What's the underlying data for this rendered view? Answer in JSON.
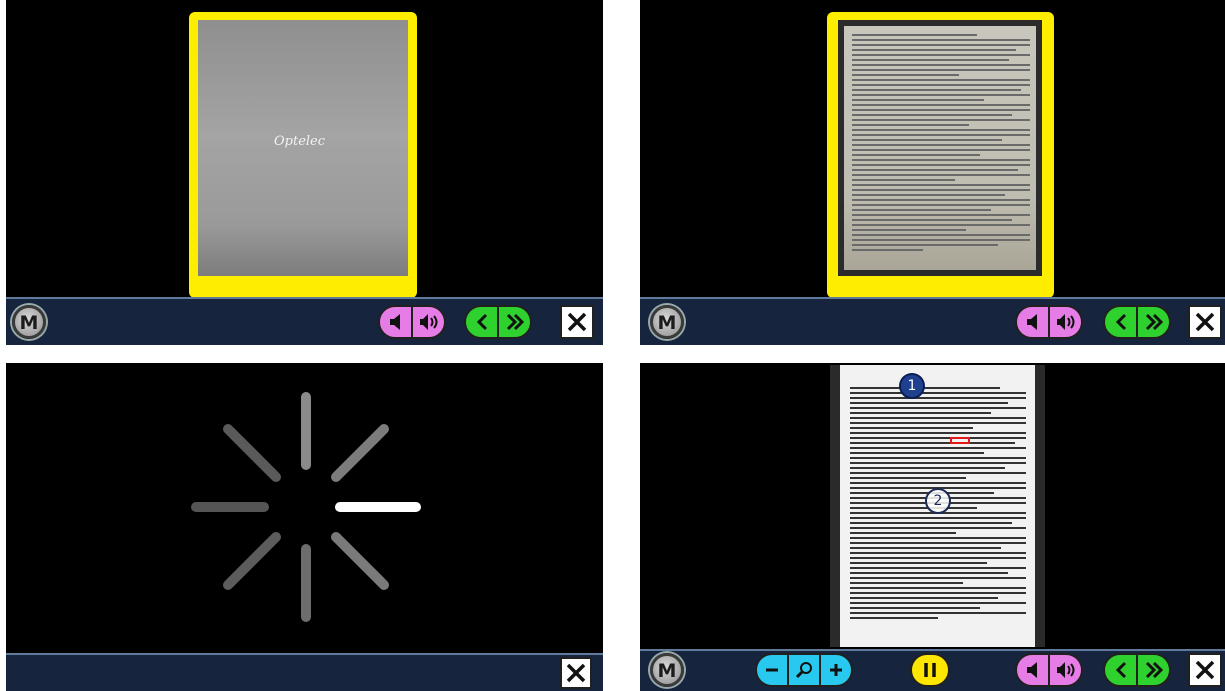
{
  "panels": {
    "p1": {
      "logo_text": "Optelec"
    },
    "p4": {
      "marker_1": "1",
      "marker_2": "2"
    }
  },
  "toolbar": {
    "menu_label": "M",
    "icons": {
      "volume_down": "speaker-low-icon",
      "volume_up": "speaker-high-icon",
      "previous": "chevron-left-icon",
      "next": "double-chevron-right-icon",
      "close": "close-icon",
      "zoom_out": "minus-icon",
      "zoom": "magnifier-icon",
      "zoom_in": "plus-icon",
      "pause": "pause-icon"
    }
  },
  "colors": {
    "frame": "#ffed00",
    "toolbar_bg": "#16243e",
    "volume_pill": "#e67de6",
    "nav_pill": "#2fd12f",
    "zoom_pill": "#29c8ee",
    "pause_button": "#ffe600"
  }
}
